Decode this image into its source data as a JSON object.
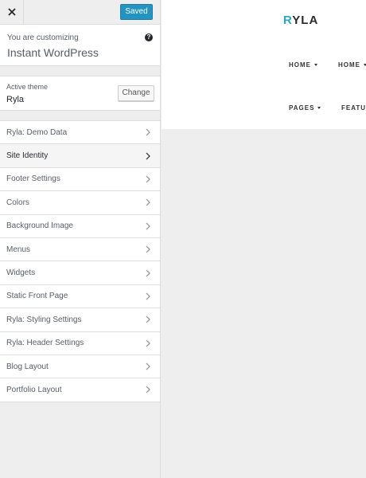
{
  "header": {
    "save_label": "Saved"
  },
  "info": {
    "action": "You are customizing",
    "site_title": "Instant WordPress",
    "help_symbol": "?"
  },
  "theme": {
    "label": "Active theme",
    "name": "Ryla",
    "change_label": "Change"
  },
  "sections": [
    {
      "label": "Ryla: Demo Data",
      "active": false
    },
    {
      "label": "Site Identity",
      "active": true
    },
    {
      "label": "Footer Settings",
      "active": false
    },
    {
      "label": "Colors",
      "active": false
    },
    {
      "label": "Background Image",
      "active": false
    },
    {
      "label": "Menus",
      "active": false
    },
    {
      "label": "Widgets",
      "active": false
    },
    {
      "label": "Static Front Page",
      "active": false
    },
    {
      "label": "Ryla: Styling Settings",
      "active": false
    },
    {
      "label": "Ryla: Header Settings",
      "active": false
    },
    {
      "label": "Blog Layout",
      "active": false
    },
    {
      "label": "Portfolio Layout",
      "active": false
    }
  ],
  "preview": {
    "logo_accent": "R",
    "logo_rest": "YLA",
    "nav": {
      "home_1": "HOME",
      "home_2": "HOME",
      "pages": "PAGES",
      "features": "FEATUR"
    }
  },
  "colors": {
    "primary_button": "#0085ba",
    "logo_accent": "#2aa8c0",
    "sidebar_bg": "#eeeeee"
  }
}
